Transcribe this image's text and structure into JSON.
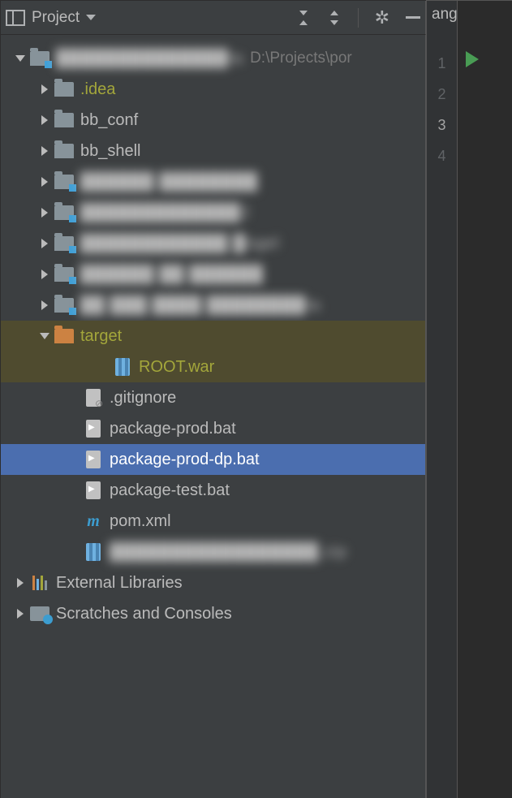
{
  "toolbar": {
    "label": "Project"
  },
  "tab": {
    "label": "angel\\p"
  },
  "gutter": {
    "lines": [
      "1",
      "2",
      "3",
      "4"
    ]
  },
  "tree": {
    "root": {
      "label": "██████████████ta",
      "path": "D:\\Projects\\por"
    },
    "idea": ".idea",
    "bb_conf": "bb_conf",
    "bb_shell": "bb_shell",
    "mod1": "██████ ████████",
    "mod2": "█████████████2",
    "mod3": "████████████ █ngel",
    "mod4": "██████ ██ ██████",
    "mod5": "██ ███ ████ ████████ta",
    "target": "target",
    "rootwar": "ROOT.war",
    "gitignore": ".gitignore",
    "pkg_prod": "package-prod.bat",
    "pkg_prod_dp": "package-prod-dp.bat",
    "pkg_test": "package-test.bat",
    "pom": "pom.xml",
    "zip": "█████████████████.zip",
    "ext_lib": "External Libraries",
    "scratches": "Scratches and Consoles"
  }
}
